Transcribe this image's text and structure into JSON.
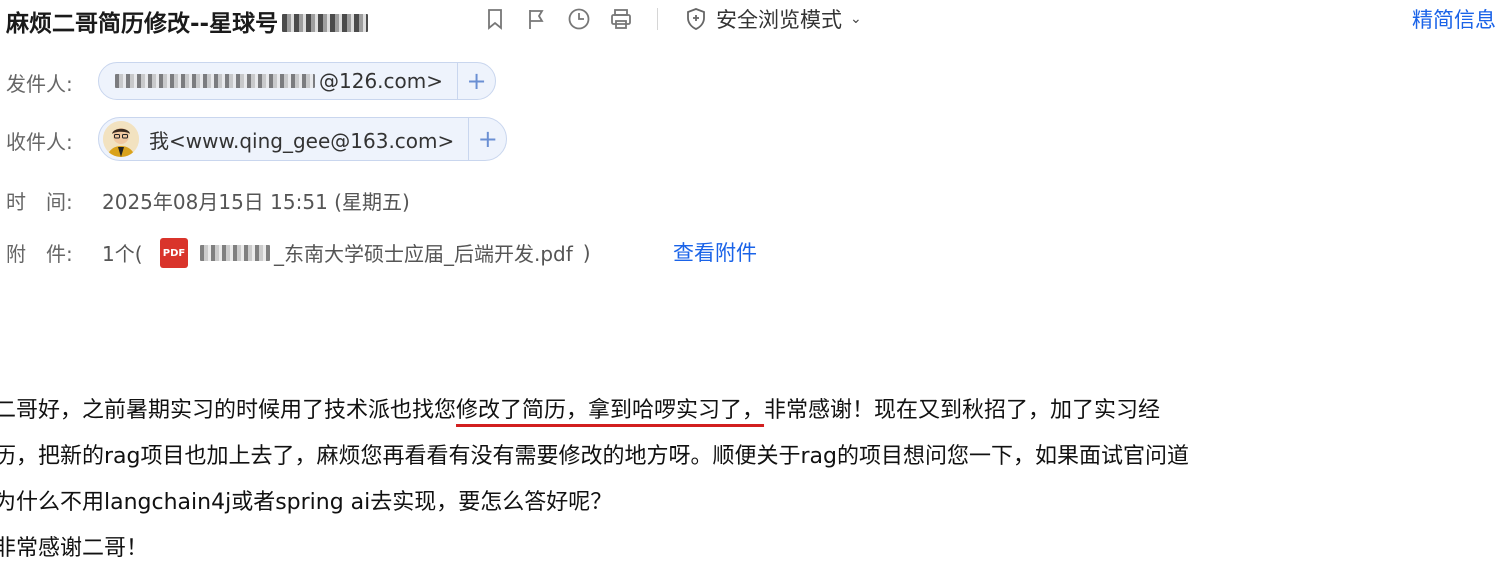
{
  "header": {
    "subject": "麻烦二哥简历修改--星球号",
    "safe_mode_label": "安全浏览模式",
    "simple_info_link": "精简信息"
  },
  "toolbar": {
    "icons": [
      "bookmark-icon",
      "flag-icon",
      "clock-icon",
      "print-icon"
    ]
  },
  "meta": {
    "sender_label": "发件人:",
    "sender_email_domain": "@126.com>",
    "recipient_label": "收件人:",
    "recipient": "我<www.qing_gee@163.com>",
    "time_label": "时　间:",
    "time_value": "2025年08月15日 15:51 (星期五)",
    "attachment_label": "附　件:",
    "attachment_count": "1个(",
    "attachment_name": "_东南大学硕士应届_后端开发.pdf",
    "attachment_close": ")",
    "view_attachment_link": "查看附件"
  },
  "body": {
    "line1_pre": "二哥好，之前暑期实习的时候用了技术派也找您",
    "line1_highlight": "修改了简历，拿到哈啰实习了，",
    "line1_post": "非常感谢！现在又到秋招了，加了实习经",
    "line2": "历，把新的rag项目也加上去了，麻烦您再看看有没有需要修改的地方呀。顺便关于rag的项目想问您一下，如果面试官问道",
    "line3": "为什么不用langchain4j或者spring ai去实现，要怎么答好呢？",
    "line4": "非常感谢二哥！"
  },
  "colors": {
    "link": "#1a63e8",
    "underline": "#d21f1f",
    "pill_bg": "#eef3fc",
    "pdf": "#d9342b"
  }
}
